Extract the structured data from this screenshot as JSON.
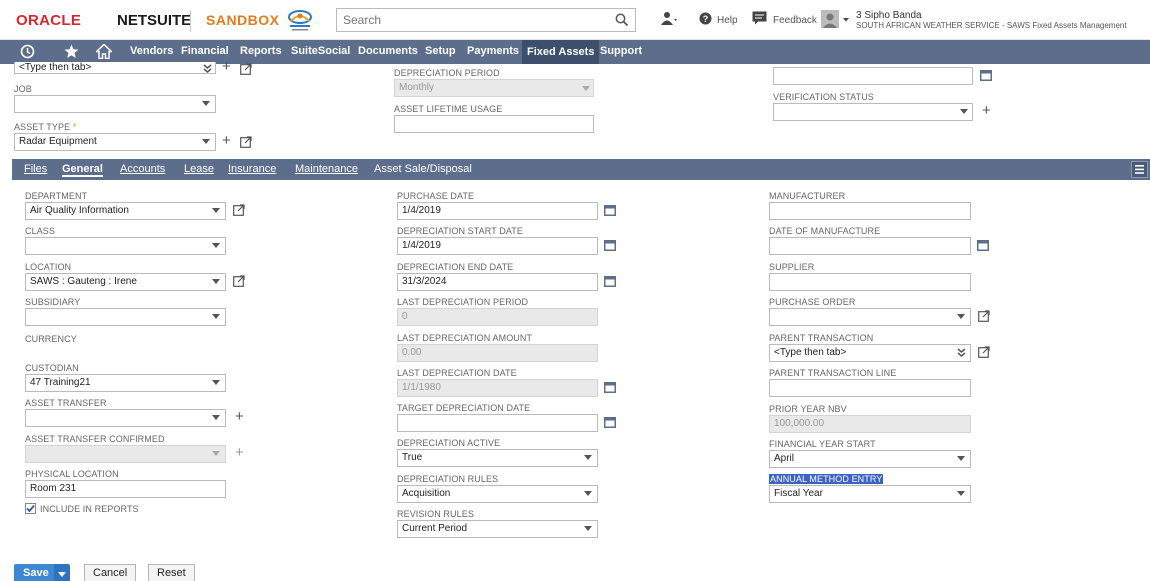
{
  "header": {
    "brand_oracle": "ORACLE",
    "brand_netsuite": "NETSUITE",
    "environment": "SANDBOX",
    "logo_text": "South African Weather Service",
    "search_placeholder": "Search",
    "help": "Help",
    "feedback": "Feedback",
    "user_name": "3 Sipho Banda",
    "user_role": "SOUTH AFRICAN WEATHER SERVICE - SAWS Fixed Assets Management"
  },
  "nav": {
    "items": [
      "Vendors",
      "Financial",
      "Reports",
      "SuiteSocial",
      "Documents",
      "Setup",
      "Payments",
      "Fixed Assets",
      "Support"
    ],
    "active": "Fixed Assets"
  },
  "top_form": {
    "col1_top_value": "<Type then tab>",
    "job_label": "JOB",
    "job_value": "",
    "asset_type_label": "ASSET TYPE",
    "asset_type_required": "*",
    "asset_type_value": "Radar Equipment",
    "dep_period_label": "DEPRECIATION PERIOD",
    "dep_period_value": "Monthly",
    "lifetime_label": "ASSET LIFETIME USAGE",
    "lifetime_value": "",
    "col3_top_value": "",
    "verification_label": "VERIFICATION STATUS",
    "verification_value": ""
  },
  "subtabs": {
    "items": [
      "Files",
      "General",
      "Accounts",
      "Lease",
      "Insurance",
      "Maintenance",
      "Asset Sale/Disposal"
    ],
    "active": "General"
  },
  "general": {
    "col1": {
      "department_label": "DEPARTMENT",
      "department_value": "Air Quality Information",
      "class_label": "CLASS",
      "class_value": "",
      "location_label": "LOCATION",
      "location_value": "SAWS : Gauteng : Irene",
      "subsidiary_label": "SUBSIDIARY",
      "subsidiary_value": "",
      "currency_label": "CURRENCY",
      "custodian_label": "CUSTODIAN",
      "custodian_value": "47 Training21",
      "asset_transfer_label": "ASSET TRANSFER",
      "asset_transfer_value": "",
      "asset_transfer_confirmed_label": "ASSET TRANSFER CONFIRMED",
      "asset_transfer_confirmed_value": "",
      "physical_location_label": "PHYSICAL LOCATION",
      "physical_location_value": "Room 231",
      "include_in_reports_label": "INCLUDE IN REPORTS",
      "include_in_reports_checked": true
    },
    "col2": {
      "purchase_date_label": "PURCHASE DATE",
      "purchase_date_value": "1/4/2019",
      "dep_start_label": "DEPRECIATION START DATE",
      "dep_start_value": "1/4/2019",
      "dep_end_label": "DEPRECIATION END DATE",
      "dep_end_value": "31/3/2024",
      "last_dep_period_label": "LAST DEPRECIATION PERIOD",
      "last_dep_period_value": "0",
      "last_dep_amount_label": "LAST DEPRECIATION AMOUNT",
      "last_dep_amount_value": "0.00",
      "last_dep_date_label": "LAST DEPRECIATION DATE",
      "last_dep_date_value": "1/1/1980",
      "target_dep_date_label": "TARGET DEPRECIATION DATE",
      "target_dep_date_value": "",
      "dep_active_label": "DEPRECIATION ACTIVE",
      "dep_active_value": "True",
      "dep_rules_label": "DEPRECIATION RULES",
      "dep_rules_value": "Acquisition",
      "revision_rules_label": "REVISION RULES",
      "revision_rules_value": "Current Period"
    },
    "col3": {
      "manufacturer_label": "MANUFACTURER",
      "manufacturer_value": "",
      "date_of_manufacture_label": "DATE OF MANUFACTURE",
      "date_of_manufacture_value": "",
      "supplier_label": "SUPPLIER",
      "supplier_value": "",
      "purchase_order_label": "PURCHASE ORDER",
      "purchase_order_value": "",
      "parent_transaction_label": "PARENT TRANSACTION",
      "parent_transaction_value": "<Type then tab>",
      "parent_transaction_line_label": "PARENT TRANSACTION LINE",
      "parent_transaction_line_value": "",
      "prior_year_nbv_label": "PRIOR YEAR NBV",
      "prior_year_nbv_value": "100,000.00",
      "fy_start_label": "FINANCIAL YEAR START",
      "fy_start_value": "April",
      "annual_method_label": "ANNUAL METHOD ENTRY",
      "annual_method_value": "Fiscal Year"
    }
  },
  "buttons": {
    "save": "Save",
    "cancel": "Cancel",
    "reset": "Reset"
  },
  "colors": {
    "nav_bg": "#5d6e8c",
    "save_bg": "#3e87d3",
    "oracle_red": "#d8262e",
    "sandbox_orange": "#e37b1e",
    "highlight": "#3b63c7"
  }
}
